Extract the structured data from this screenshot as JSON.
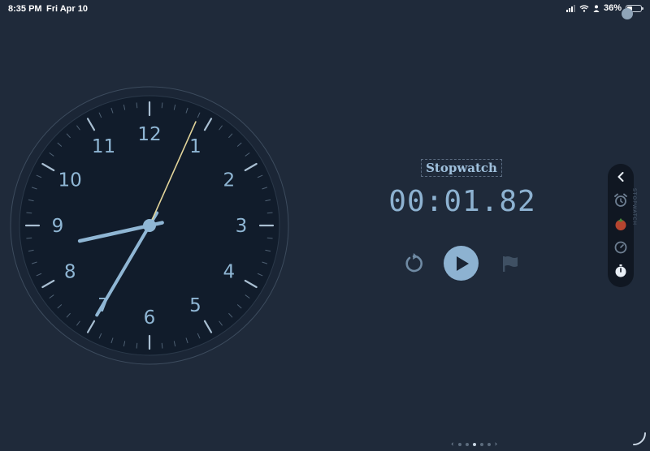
{
  "status_bar": {
    "time": "8:35 PM",
    "date": "Fri Apr 10",
    "battery": "36%",
    "battery_level": 0.36
  },
  "clock": {
    "numerals": [
      "12",
      "1",
      "2",
      "3",
      "4",
      "5",
      "6",
      "7",
      "8",
      "9",
      "10",
      "11"
    ],
    "hour": 8,
    "minute": 35,
    "second": 4,
    "colors": {
      "face": "#111c2b",
      "hands": "#8fb6d4",
      "second_hand": "#e2d49a"
    }
  },
  "stopwatch": {
    "title": "Stopwatch",
    "elapsed": "00:01.82"
  },
  "side_panel": {
    "items": [
      "chevron-left-icon",
      "alarm-clock-icon",
      "tomato-icon",
      "timer-icon",
      "stopwatch-icon"
    ],
    "vertical_label": "STOPWATCH"
  },
  "pager": {
    "count": 5,
    "active": 2
  },
  "colors": {
    "background": "#1f2a3a",
    "accent": "#8db2d1"
  }
}
